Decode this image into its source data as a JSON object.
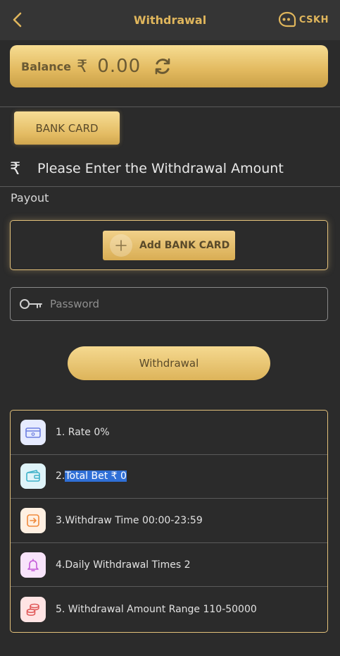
{
  "header": {
    "title": "Withdrawal",
    "support_label": "CSKH"
  },
  "balance": {
    "label": "Balance",
    "currency": "₹",
    "amount": "0.00"
  },
  "tabs": [
    {
      "label": "BANK CARD",
      "selected": true
    }
  ],
  "amount": {
    "currency": "₹",
    "placeholder": "Please Enter the Withdrawal Amount"
  },
  "payout": {
    "label": "Payout",
    "add_button_label": "Add BANK CARD"
  },
  "password": {
    "placeholder": "Password"
  },
  "submit": {
    "label": "Withdrawal"
  },
  "info": [
    {
      "prefix": "1. Rate 0%",
      "highlight": "",
      "icon": "card-icon"
    },
    {
      "prefix": "2.",
      "highlight": "Total Bet ₹ 0",
      "icon": "wallet-icon"
    },
    {
      "prefix": "3.Withdraw Time 00:00-23:59",
      "highlight": "",
      "icon": "transfer-icon"
    },
    {
      "prefix": "4.Daily Withdrawal Times 2",
      "highlight": "",
      "icon": "bell-icon"
    },
    {
      "prefix": "5. Withdrawal Amount Range 110-50000",
      "highlight": "",
      "icon": "coins-icon"
    }
  ],
  "colors": {
    "accent": "#e0b65c",
    "background": "#2b2b2b",
    "header": "#353535",
    "highlight": "#2f6fd6"
  }
}
